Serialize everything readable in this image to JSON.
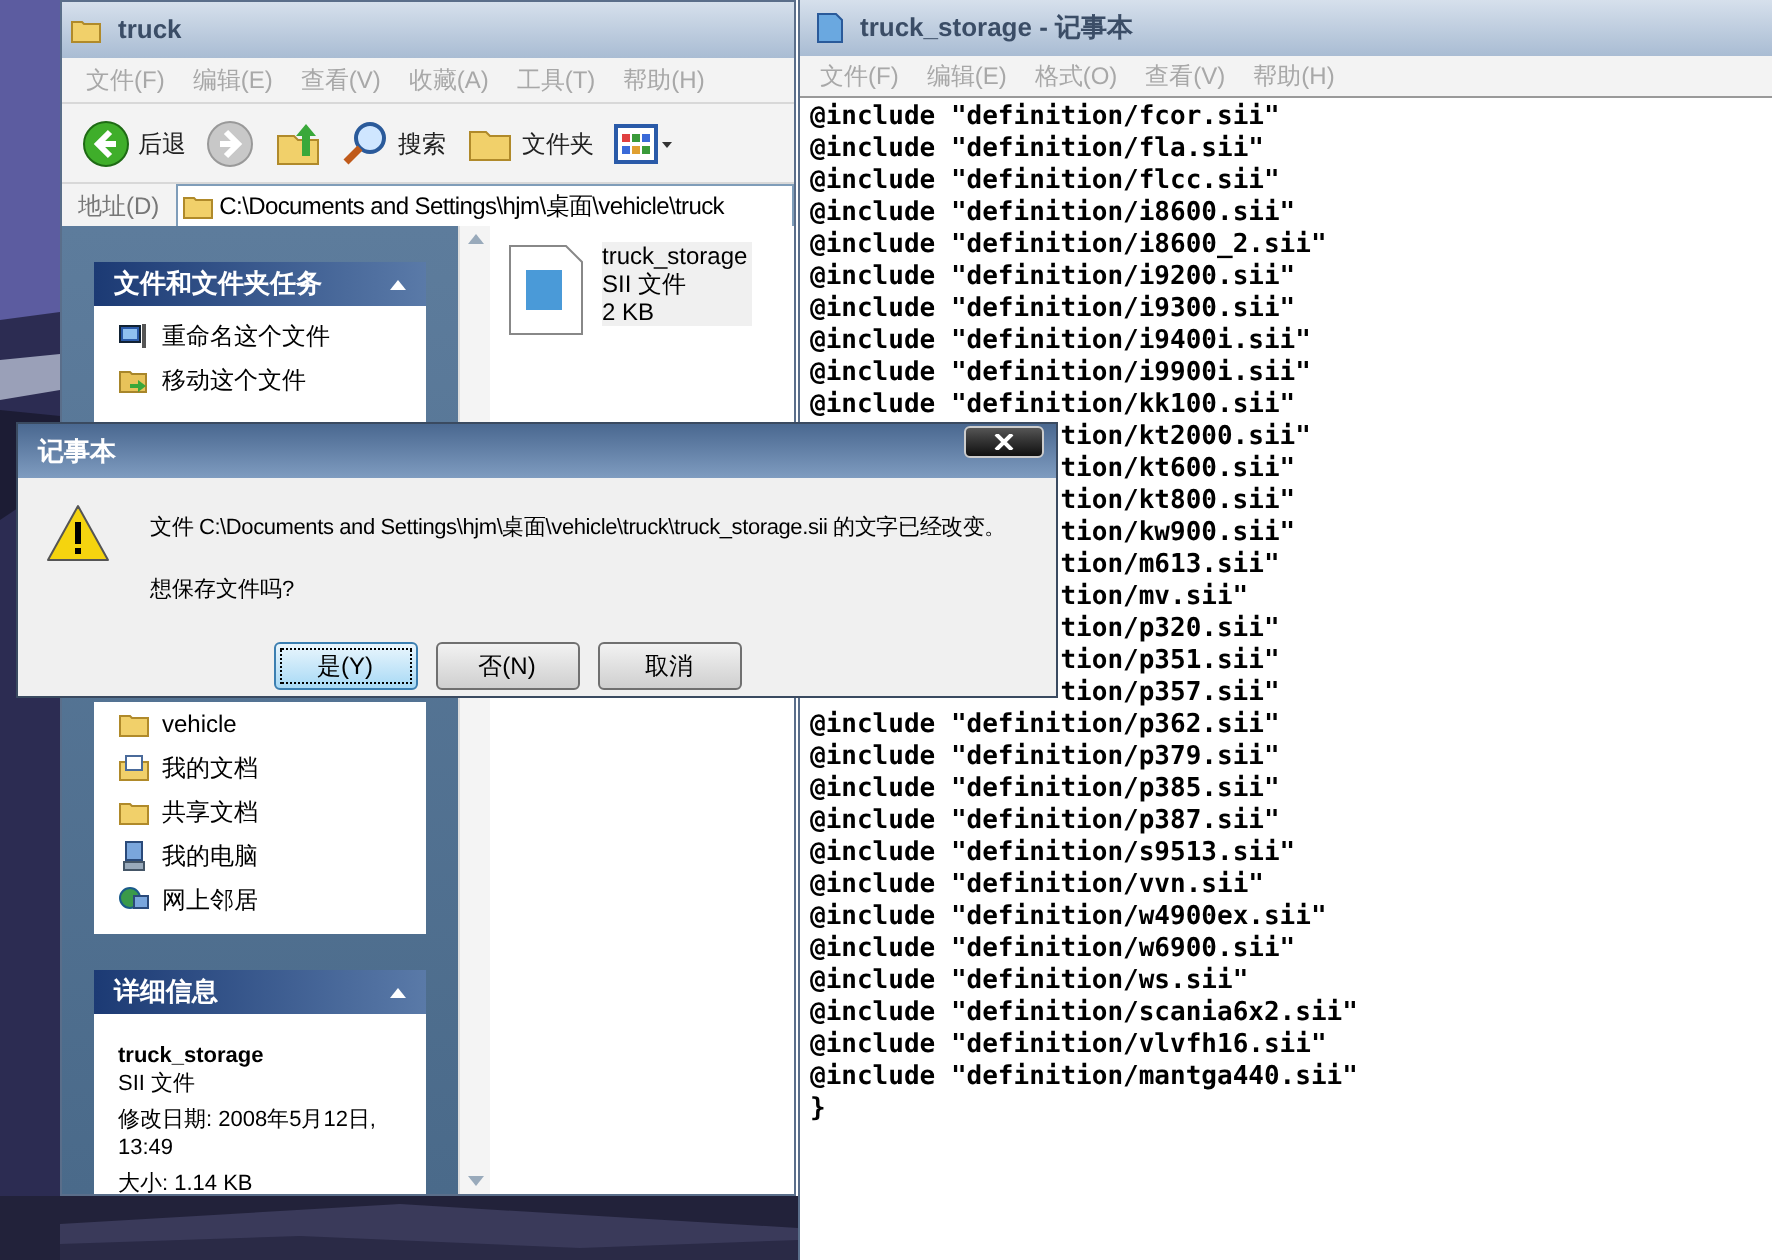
{
  "explorer": {
    "title": "truck",
    "menu": [
      "文件(F)",
      "编辑(E)",
      "查看(V)",
      "收藏(A)",
      "工具(T)",
      "帮助(H)"
    ],
    "toolbar": [
      {
        "kind": "back",
        "label": "后退"
      },
      {
        "kind": "forward"
      },
      {
        "kind": "up"
      },
      {
        "kind": "search",
        "label": "搜索"
      },
      {
        "kind": "folders",
        "label": "文件夹"
      },
      {
        "kind": "views"
      }
    ],
    "address": {
      "label": "地址(D)",
      "value": "C:\\Documents and Settings\\hjm\\桌面\\vehicle\\truck"
    },
    "tasks": {
      "title": "文件和文件夹任务",
      "items": [
        {
          "kind": "rename",
          "label": "重命名这个文件"
        },
        {
          "kind": "move",
          "label": "移动这个文件"
        }
      ]
    },
    "places": {
      "items": [
        {
          "kind": "folder",
          "label": "vehicle"
        },
        {
          "kind": "documents",
          "label": "我的文档"
        },
        {
          "kind": "folder",
          "label": "共享文档"
        },
        {
          "kind": "computer",
          "label": "我的电脑"
        },
        {
          "kind": "network",
          "label": "网上邻居"
        }
      ]
    },
    "details": {
      "title": "详细信息",
      "name": "truck_storage",
      "type": "SII 文件",
      "modified": "修改日期: 2008年5月12日, 13:49",
      "size": "大小: 1.14 KB"
    },
    "files": [
      {
        "name": "truck_storage",
        "type": "SII 文件",
        "size": "2 KB"
      }
    ]
  },
  "notepad": {
    "title": "truck_storage - 记事本",
    "menu": [
      "文件(F)",
      "编辑(E)",
      "格式(O)",
      "查看(V)",
      "帮助(H)"
    ],
    "lines": [
      {
        "kind": "full",
        "text": "@include \"definition/fcor.sii\""
      },
      {
        "kind": "full",
        "text": "@include \"definition/fla.sii\""
      },
      {
        "kind": "full",
        "text": "@include \"definition/flcc.sii\""
      },
      {
        "kind": "full",
        "text": "@include \"definition/i8600.sii\""
      },
      {
        "kind": "full",
        "text": "@include \"definition/i8600_2.sii\""
      },
      {
        "kind": "full",
        "text": "@include \"definition/i9200.sii\""
      },
      {
        "kind": "full",
        "text": "@include \"definition/i9300.sii\""
      },
      {
        "kind": "full",
        "text": "@include \"definition/i9400i.sii\""
      },
      {
        "kind": "full",
        "text": "@include \"definition/i9900i.sii\""
      },
      {
        "kind": "full",
        "text": "@include \"definition/kk100.sii\""
      },
      {
        "kind": "covered",
        "text": "tion/kt2000.sii\""
      },
      {
        "kind": "covered",
        "text": "tion/kt600.sii\""
      },
      {
        "kind": "covered",
        "text": "tion/kt800.sii\""
      },
      {
        "kind": "covered",
        "text": "tion/kw900.sii\""
      },
      {
        "kind": "covered",
        "text": "tion/m613.sii\""
      },
      {
        "kind": "covered",
        "text": "tion/mv.sii\""
      },
      {
        "kind": "covered",
        "text": "tion/p320.sii\""
      },
      {
        "kind": "covered",
        "text": "tion/p351.sii\""
      },
      {
        "kind": "covered",
        "text": "tion/p357.sii\""
      },
      {
        "kind": "full",
        "text": "@include \"definition/p362.sii\""
      },
      {
        "kind": "full",
        "text": "@include \"definition/p379.sii\""
      },
      {
        "kind": "full",
        "text": "@include \"definition/p385.sii\""
      },
      {
        "kind": "full",
        "text": "@include \"definition/p387.sii\""
      },
      {
        "kind": "full",
        "text": "@include \"definition/s9513.sii\""
      },
      {
        "kind": "full",
        "text": "@include \"definition/vvn.sii\""
      },
      {
        "kind": "full",
        "text": "@include \"definition/w4900ex.sii\""
      },
      {
        "kind": "full",
        "text": "@include \"definition/w6900.sii\""
      },
      {
        "kind": "full",
        "text": "@include \"definition/ws.sii\""
      },
      {
        "kind": "full",
        "text": "@include \"definition/scania6x2.sii\""
      },
      {
        "kind": "full",
        "text": "@include \"definition/vlvfh16.sii\""
      },
      {
        "kind": "full",
        "text": "@include \"definition/mantga440.sii\""
      },
      {
        "kind": "full",
        "text": "}"
      }
    ]
  },
  "dialog": {
    "title": "记事本",
    "message": "文件 C:\\Documents and Settings\\hjm\\桌面\\vehicle\\truck\\truck_storage.sii 的文字已经改变。",
    "question": "想保存文件吗?",
    "buttons": [
      {
        "label": "是(Y)",
        "selected": true
      },
      {
        "label": "否(N)",
        "selected": false
      },
      {
        "label": "取消",
        "selected": false
      }
    ]
  }
}
